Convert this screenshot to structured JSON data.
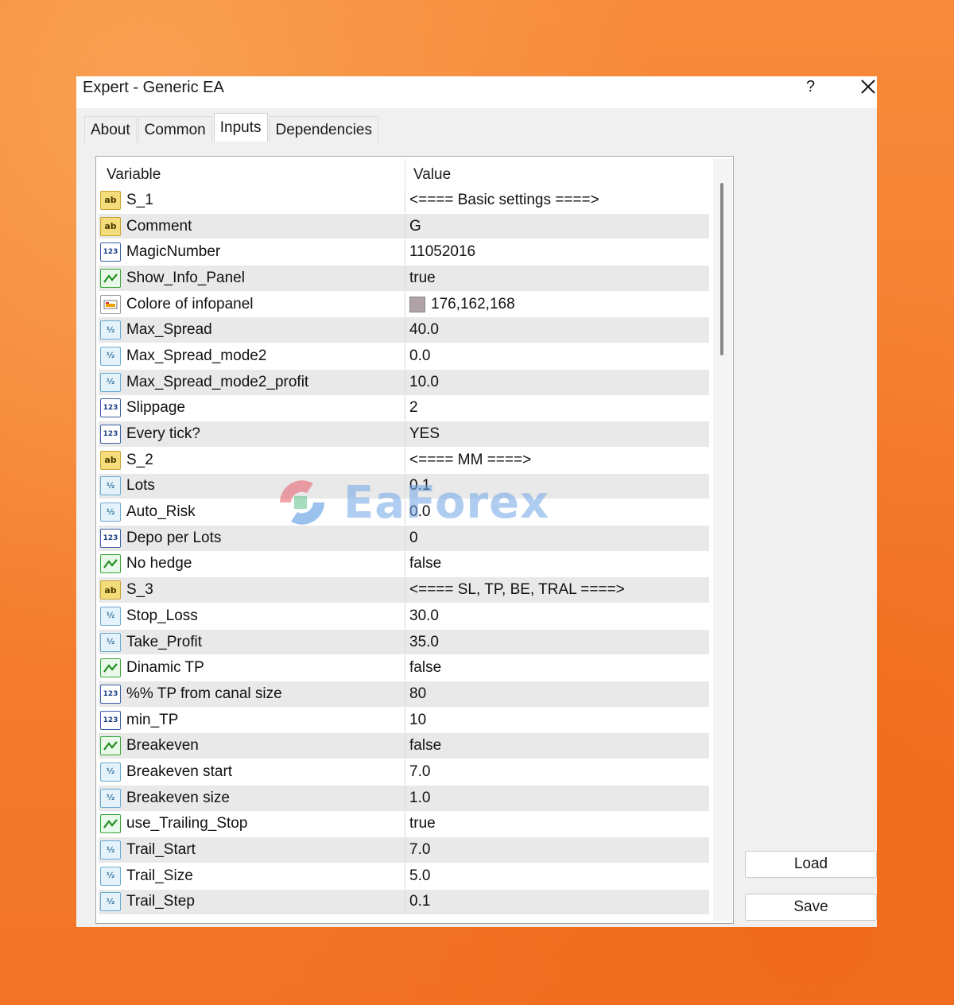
{
  "window": {
    "title": "Expert - Generic EA",
    "help_label": "?"
  },
  "tabs": [
    {
      "label": "About"
    },
    {
      "label": "Common"
    },
    {
      "label": "Inputs"
    },
    {
      "label": "Dependencies"
    }
  ],
  "active_tab": "Inputs",
  "grid": {
    "headers": {
      "variable": "Variable",
      "value": "Value"
    },
    "rows": [
      {
        "type": "string",
        "icon": "string-type-icon",
        "variable": "S_1",
        "value": "<==== Basic settings ====>"
      },
      {
        "type": "string",
        "icon": "string-type-icon",
        "variable": "Comment",
        "value": "G"
      },
      {
        "type": "int",
        "icon": "integer-type-icon",
        "variable": "MagicNumber",
        "value": "11052016"
      },
      {
        "type": "bool",
        "icon": "boolean-type-icon",
        "variable": "Show_Info_Panel",
        "value": "true"
      },
      {
        "type": "color",
        "icon": "color-type-icon",
        "variable": "Colore of infopanel",
        "value": "176,162,168",
        "swatch": "#b0a2a8"
      },
      {
        "type": "double",
        "icon": "double-type-icon",
        "variable": "Max_Spread",
        "value": "40.0"
      },
      {
        "type": "double",
        "icon": "double-type-icon",
        "variable": "Max_Spread_mode2",
        "value": "0.0"
      },
      {
        "type": "double",
        "icon": "double-type-icon",
        "variable": "Max_Spread_mode2_profit",
        "value": "10.0"
      },
      {
        "type": "int",
        "icon": "integer-type-icon",
        "variable": "Slippage",
        "value": "2"
      },
      {
        "type": "int",
        "icon": "integer-type-icon",
        "variable": "Every tick?",
        "value": "YES"
      },
      {
        "type": "string",
        "icon": "string-type-icon",
        "variable": "S_2",
        "value": "<==== MM ====>"
      },
      {
        "type": "double",
        "icon": "double-type-icon",
        "variable": "Lots",
        "value": "0.1"
      },
      {
        "type": "double",
        "icon": "double-type-icon",
        "variable": "Auto_Risk",
        "value": "0.0"
      },
      {
        "type": "int",
        "icon": "integer-type-icon",
        "variable": "Depo per Lots",
        "value": "0"
      },
      {
        "type": "bool",
        "icon": "boolean-type-icon",
        "variable": "No hedge",
        "value": "false"
      },
      {
        "type": "string",
        "icon": "string-type-icon",
        "variable": "S_3",
        "value": "<==== SL, TP, BE, TRAL ====>"
      },
      {
        "type": "double",
        "icon": "double-type-icon",
        "variable": "Stop_Loss",
        "value": "30.0"
      },
      {
        "type": "double",
        "icon": "double-type-icon",
        "variable": "Take_Profit",
        "value": "35.0"
      },
      {
        "type": "bool",
        "icon": "boolean-type-icon",
        "variable": "Dinamic TP",
        "value": "false"
      },
      {
        "type": "int",
        "icon": "integer-type-icon",
        "variable": "%% TP from canal size",
        "value": "80"
      },
      {
        "type": "int",
        "icon": "integer-type-icon",
        "variable": "min_TP",
        "value": "10"
      },
      {
        "type": "bool",
        "icon": "boolean-type-icon",
        "variable": "Breakeven",
        "value": "false"
      },
      {
        "type": "double",
        "icon": "double-type-icon",
        "variable": "Breakeven start",
        "value": "7.0"
      },
      {
        "type": "double",
        "icon": "double-type-icon",
        "variable": "Breakeven size",
        "value": "1.0"
      },
      {
        "type": "bool",
        "icon": "boolean-type-icon",
        "variable": "use_Trailing_Stop",
        "value": "true"
      },
      {
        "type": "double",
        "icon": "double-type-icon",
        "variable": "Trail_Start",
        "value": "7.0"
      },
      {
        "type": "double",
        "icon": "double-type-icon",
        "variable": "Trail_Size",
        "value": "5.0"
      },
      {
        "type": "double",
        "icon": "double-type-icon",
        "variable": "Trail_Step",
        "value": "0.1"
      }
    ]
  },
  "buttons": {
    "load_label": "Load",
    "save_label": "Save"
  },
  "watermark": {
    "text": "EaForex"
  },
  "colors": {
    "background": "#f47a2a",
    "dialog": "#f0f0f0",
    "row_alt": "#e9e9e9"
  }
}
